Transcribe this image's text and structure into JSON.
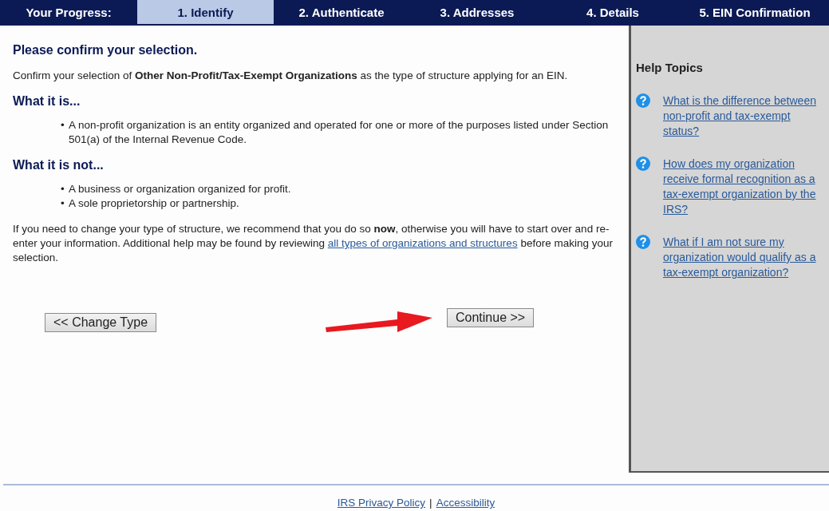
{
  "progress": {
    "label": "Your Progress:",
    "steps": [
      {
        "label": "1. Identify",
        "selected": true
      },
      {
        "label": "2. Authenticate",
        "selected": false
      },
      {
        "label": "3. Addresses",
        "selected": false
      },
      {
        "label": "4. Details",
        "selected": false
      },
      {
        "label": "5. EIN Confirmation",
        "selected": false
      }
    ]
  },
  "main": {
    "title": "Please confirm your selection.",
    "intro": "Confirm your selection of **Other Non-Profit/Tax-Exempt Organizations** as the type of structure applying for an EIN.",
    "bullet": "•",
    "sections": [
      {
        "heading": "What it is...",
        "bullets": [
          "A non-profit organization is an entity organized and operated for one or more of the purposes listed under Section 501(a) of the Internal Revenue Code."
        ]
      },
      {
        "heading": "What it is not...",
        "bullets": [
          "A business or organization organized for profit.",
          "A sole proprietorship or partnership."
        ]
      }
    ],
    "closing": {
      "before": "If you need to change your type of structure, we recommend that you do so **now**, otherwise you will have to start over and re-enter your information.  Additional help may be found by reviewing",
      "link": "all types of organizations and structures",
      "after": "before making your selection."
    },
    "buttons": [
      "<< Change Type",
      "Continue >>"
    ]
  },
  "help": {
    "title": "Help Topics",
    "topics": [
      "What is the difference between non-profit and tax-exempt status?",
      "How does my organization receive formal recognition as a tax-exempt organization by the IRS?",
      "What if I am not sure my organization would qualify as a tax-exempt organization?"
    ]
  },
  "footer": {
    "links": [
      "IRS Privacy Policy",
      "Accessibility"
    ],
    "separator": "|"
  }
}
